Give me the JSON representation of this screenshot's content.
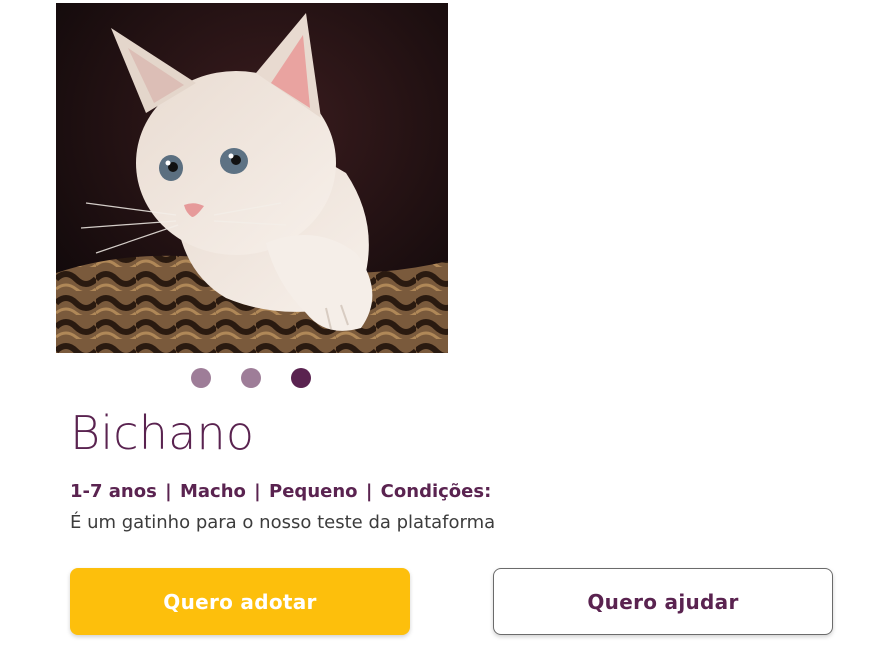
{
  "colors": {
    "brand_purple": "#5a2350",
    "dot_inactive": "#9e7d98",
    "dot_active": "#5a2350",
    "adopt_button_bg": "#fdbf0c",
    "adopt_button_text": "#ffffff",
    "help_button_text": "#5a2350"
  },
  "gallery": {
    "image_icon": "kitten-photo",
    "active_index": 2,
    "dot_count": 3
  },
  "pet": {
    "name": "Bichano",
    "age": "1-7 anos",
    "sex": "Macho",
    "size": "Pequeno",
    "conditions_label": "Condições:",
    "separator": "|",
    "description": "É um gatinho para o nosso teste da plataforma"
  },
  "actions": {
    "adopt_label": "Quero adotar",
    "help_label": "Quero ajudar"
  }
}
